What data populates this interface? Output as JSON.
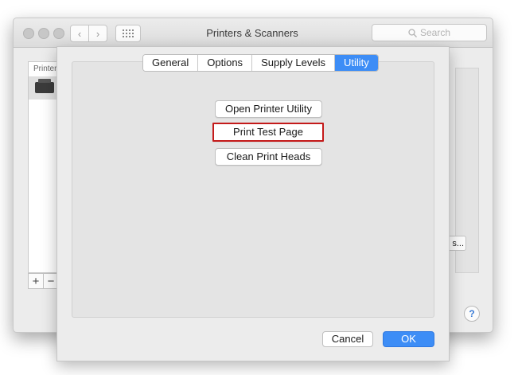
{
  "window": {
    "title": "Printers & Scanners",
    "search_placeholder": "Search",
    "nav_back": "‹",
    "nav_forward": "›"
  },
  "printer_list": {
    "header": "Printers",
    "add": "+",
    "remove": "−"
  },
  "options_button": "s...",
  "help": "?",
  "sheet": {
    "tabs": [
      {
        "label": "General",
        "active": false
      },
      {
        "label": "Options",
        "active": false
      },
      {
        "label": "Supply Levels",
        "active": false
      },
      {
        "label": "Utility",
        "active": true
      }
    ],
    "utility_buttons": {
      "open": "Open Printer Utility",
      "print_test": "Print Test Page",
      "clean_heads": "Clean Print Heads"
    },
    "cancel": "Cancel",
    "ok": "OK"
  },
  "colors": {
    "accent": "#3d8df6",
    "highlight": "#c41a1a"
  }
}
